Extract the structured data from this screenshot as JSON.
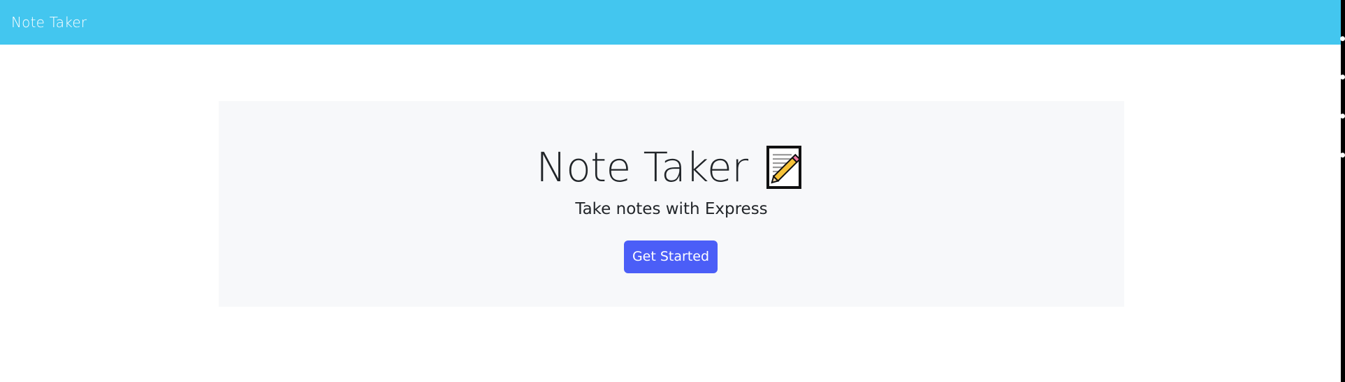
{
  "navbar": {
    "brand": "Note Taker"
  },
  "hero": {
    "title": "Note Taker",
    "icon": "memo-icon",
    "subtitle": "Take notes with Express",
    "button_label": "Get Started"
  },
  "colors": {
    "navbar_bg": "#43c6ef",
    "hero_bg": "#f7f8fa",
    "button_bg": "#4b5ef7",
    "text": "#212529"
  }
}
